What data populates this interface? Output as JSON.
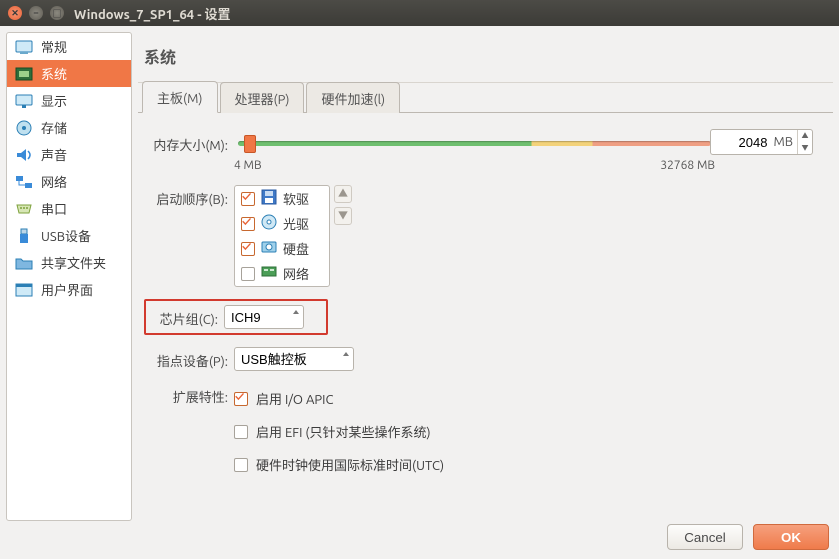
{
  "window": {
    "title": "Windows_7_SP1_64 - 设置"
  },
  "sidebar": {
    "items": [
      {
        "label": "常规"
      },
      {
        "label": "系统"
      },
      {
        "label": "显示"
      },
      {
        "label": "存储"
      },
      {
        "label": "声音"
      },
      {
        "label": "网络"
      },
      {
        "label": "串口"
      },
      {
        "label": "USB设备"
      },
      {
        "label": "共享文件夹"
      },
      {
        "label": "用户界面"
      }
    ],
    "selected_index": 1
  },
  "page": {
    "title": "系统",
    "tabs": [
      {
        "label": "主板(M)"
      },
      {
        "label": "处理器(P)"
      },
      {
        "label": "硬件加速(l)"
      }
    ],
    "active_tab": 0,
    "memory": {
      "label": "内存大小(M):",
      "value": "2048",
      "unit": "MB",
      "min_label": "4 MB",
      "max_label": "32768 MB"
    },
    "boot": {
      "label": "启动顺序(B):",
      "items": [
        {
          "label": "软驱",
          "checked": true
        },
        {
          "label": "光驱",
          "checked": true
        },
        {
          "label": "硬盘",
          "checked": true
        },
        {
          "label": "网络",
          "checked": false
        }
      ]
    },
    "chipset": {
      "label": "芯片组(C):",
      "value": "ICH9"
    },
    "pointing": {
      "label": "指点设备(P):",
      "value": "USB触控板"
    },
    "extended": {
      "label": "扩展特性:",
      "ioapic": {
        "label": "启用 I/O APIC",
        "checked": true
      },
      "efi": {
        "label": "启用 EFI (只针对某些操作系统)",
        "checked": false
      },
      "utc": {
        "label": "硬件时钟使用国际标准时间(UTC)",
        "checked": false
      }
    }
  },
  "footer": {
    "cancel": "Cancel",
    "ok": "OK"
  }
}
